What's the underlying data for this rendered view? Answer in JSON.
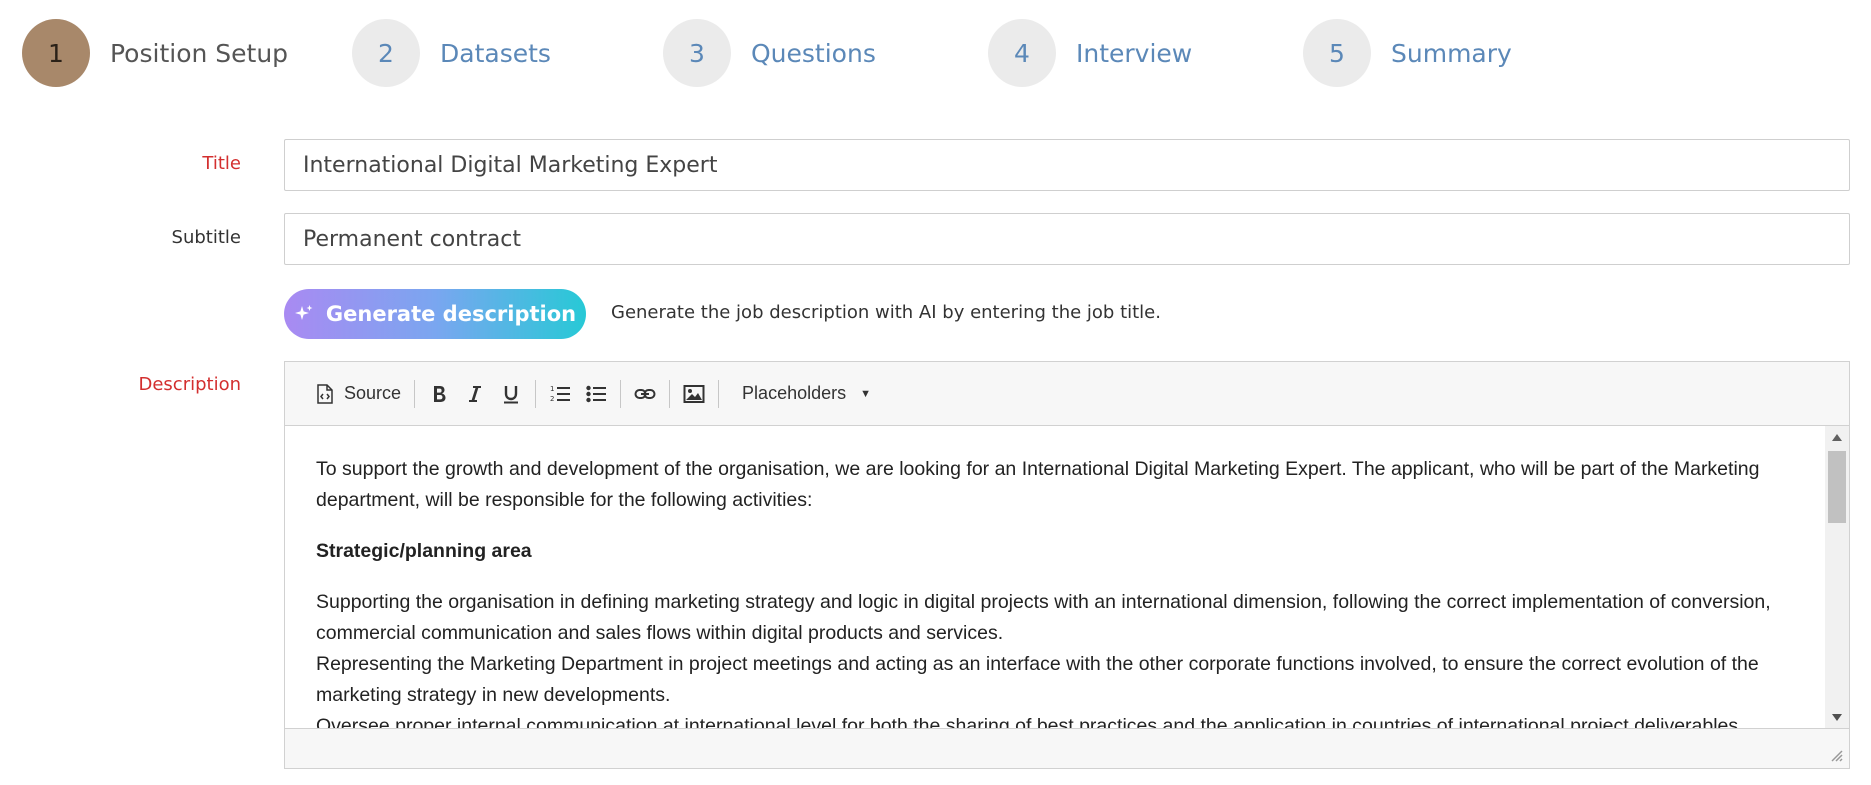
{
  "stepper": {
    "steps": [
      {
        "number": "1",
        "label": "Position Setup",
        "active": true
      },
      {
        "number": "2",
        "label": "Datasets",
        "active": false
      },
      {
        "number": "3",
        "label": "Questions",
        "active": false
      },
      {
        "number": "4",
        "label": "Interview",
        "active": false
      },
      {
        "number": "5",
        "label": "Summary",
        "active": false
      }
    ]
  },
  "form": {
    "title_label": "Title",
    "title_value": "International Digital Marketing Expert",
    "subtitle_label": "Subtitle",
    "subtitle_value": "Permanent contract",
    "generate_button_label": "Generate description",
    "generate_hint": "Generate the job description with AI by entering the job title.",
    "description_label": "Description"
  },
  "editor": {
    "toolbar": {
      "source_label": "Source",
      "placeholders_label": "Placeholders"
    },
    "content": {
      "intro": "To support the growth and development of the organisation, we are looking for an International Digital Marketing Expert. The applicant, who will be part of the Marketing department, will be responsible for the following activities:",
      "heading": "Strategic/planning area",
      "item1": "Supporting the organisation in defining marketing strategy and logic in digital projects with an international dimension, following the correct implementation of conversion, commercial communication and sales flows within digital products and services.",
      "item2": "Representing the Marketing Department in project meetings and acting as an interface with the other corporate functions involved, to ensure the correct evolution of the marketing strategy in new developments.",
      "item3": "Oversee proper internal communication at international level for both the sharing of best practices and the application in countries of international project deliverables."
    }
  },
  "colors": {
    "active_step": "#a8886a",
    "inactive_step": "#ebebeb",
    "step_link": "#5b88b8",
    "required_label": "#d32f2f",
    "gradient_start": "#a98af2",
    "gradient_end": "#27c9d6"
  },
  "icons": {
    "generate": "sparkle-icon",
    "source": "source-icon",
    "bold": "bold-icon",
    "italic": "italic-icon",
    "underline": "underline-icon",
    "numbered_list": "numbered-list-icon",
    "bulleted_list": "bulleted-list-icon",
    "link": "link-icon",
    "image": "image-icon",
    "dropdown": "caret-down-icon"
  }
}
